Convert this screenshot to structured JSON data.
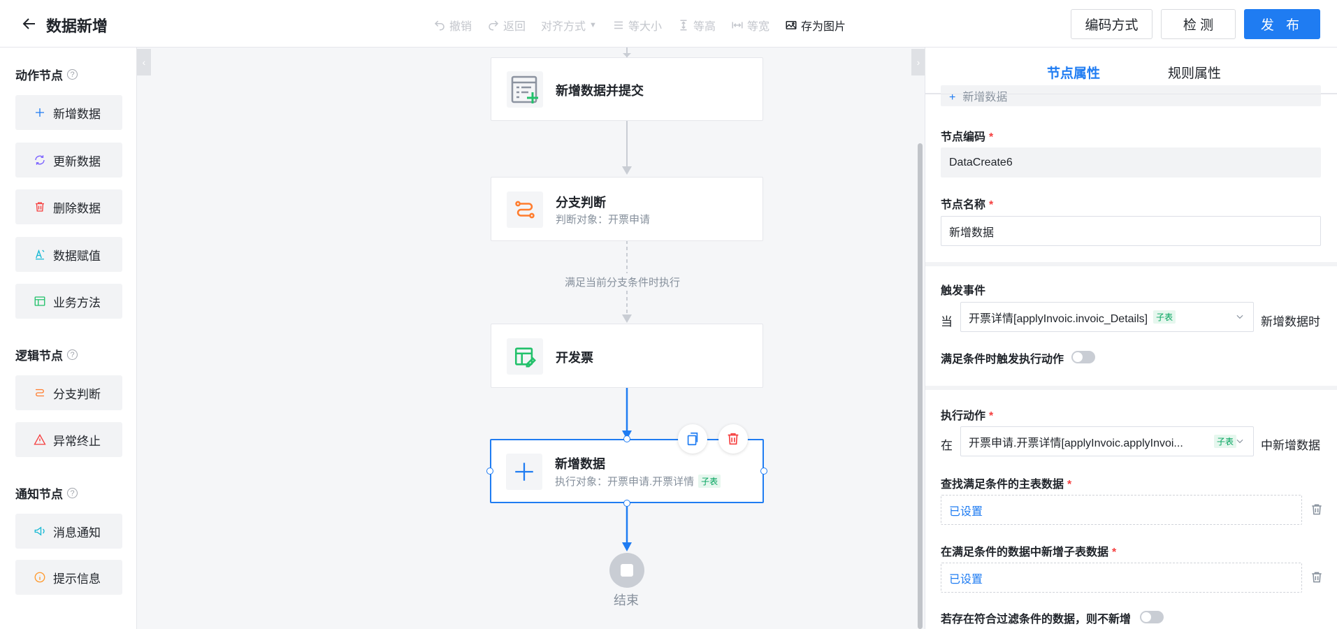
{
  "header": {
    "title": "数据新增",
    "toolbar": {
      "undo": "撤销",
      "redo": "返回",
      "align": "对齐方式",
      "same_size": "等大小",
      "same_height": "等高",
      "same_width": "等宽",
      "save_image": "存为图片"
    },
    "encoding_button": "编码方式",
    "check_button": "检 测",
    "publish_button": "发 布"
  },
  "left_panel": {
    "action_section": "动作节点",
    "actions": [
      "新增数据",
      "更新数据",
      "删除数据",
      "数据赋值",
      "业务方法"
    ],
    "logic_section": "逻辑节点",
    "logic": [
      "分支判断",
      "异常终止"
    ],
    "notify_section": "通知节点",
    "notify": [
      "消息通知",
      "提示信息"
    ]
  },
  "canvas": {
    "node_submit": "新增数据并提交",
    "node_branch": "分支判断",
    "node_branch_sub": "判断对象：开票申请",
    "edge_label": "满足当前分支条件时执行",
    "node_invoice": "开发票",
    "node_add": "新增数据",
    "node_add_sub": "执行对象：开票申请.开票详情",
    "node_add_tag": "子表",
    "end_label": "结束"
  },
  "right_panel": {
    "tab_node": "节点属性",
    "tab_rule": "规则属性",
    "type_value": "新增数据",
    "code_label": "节点编码",
    "code_value": "DataCreate6",
    "name_label": "节点名称",
    "name_value": "新增数据",
    "trigger_label": "触发事件",
    "trigger_prefix": "当",
    "trigger_select": "开票详情[applyInvoic.invoic_Details]",
    "trigger_tag": "子表",
    "trigger_suffix": "新增数据时",
    "condition_toggle_label": "满足条件时触发执行动作",
    "action_label": "执行动作",
    "action_prefix": "在",
    "action_select": "开票申请.开票详情[applyInvoic.applyInvoi...",
    "action_tag": "子表",
    "action_suffix": "中新增数据",
    "find_label": "查找满足条件的主表数据",
    "find_value": "已设置",
    "add_sub_label": "在满足条件的数据中新增子表数据",
    "add_sub_value": "已设置",
    "skip_label": "若存在符合过滤条件的数据，则不新增"
  }
}
